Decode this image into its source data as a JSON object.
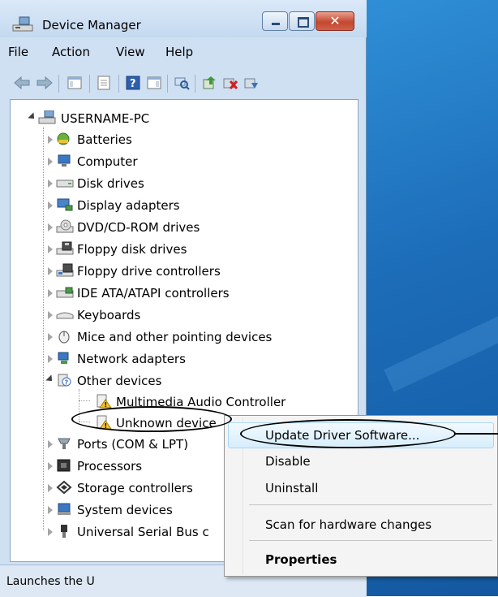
{
  "window": {
    "title": "Device Manager"
  },
  "menubar": {
    "items": [
      "File",
      "Action",
      "View",
      "Help"
    ]
  },
  "toolbar": {
    "icons": [
      "back-arrow-icon",
      "forward-arrow-icon",
      "show-hide-console-tree-icon",
      "properties-icon",
      "help-icon",
      "action-pane-icon",
      "scan-hardware-icon",
      "update-driver-icon",
      "uninstall-icon",
      "enable-device-icon"
    ]
  },
  "tree": {
    "root": "USERNAME-PC",
    "categories": [
      {
        "label": "Batteries",
        "icon": "battery-icon"
      },
      {
        "label": "Computer",
        "icon": "computer-icon"
      },
      {
        "label": "Disk drives",
        "icon": "disk-drive-icon"
      },
      {
        "label": "Display adapters",
        "icon": "display-adapter-icon"
      },
      {
        "label": "DVD/CD-ROM drives",
        "icon": "dvd-drive-icon"
      },
      {
        "label": "Floppy disk drives",
        "icon": "floppy-drive-icon"
      },
      {
        "label": "Floppy drive controllers",
        "icon": "floppy-controller-icon"
      },
      {
        "label": "IDE ATA/ATAPI controllers",
        "icon": "ide-controller-icon"
      },
      {
        "label": "Keyboards",
        "icon": "keyboard-icon"
      },
      {
        "label": "Mice and other pointing devices",
        "icon": "mouse-icon"
      },
      {
        "label": "Network adapters",
        "icon": "network-adapter-icon"
      },
      {
        "label": "Other devices",
        "icon": "unknown-device-icon"
      }
    ],
    "other_devices": [
      "Multimedia Audio Controller",
      "Unknown device"
    ],
    "categories_after": [
      {
        "label": "Ports (COM & LPT)",
        "icon": "port-icon"
      },
      {
        "label": "Processors",
        "icon": "processor-icon"
      },
      {
        "label": "Storage controllers",
        "icon": "storage-controller-icon"
      },
      {
        "label": "System devices",
        "icon": "system-device-icon"
      },
      {
        "label": "Universal Serial Bus c",
        "icon": "usb-icon"
      }
    ]
  },
  "context_menu": {
    "items": [
      "Update Driver Software...",
      "Disable",
      "Uninstall",
      "Scan for hardware changes",
      "Properties"
    ]
  },
  "statusbar": {
    "text": "Launches the U"
  },
  "colors": {
    "window_frame": "#cfe0f3",
    "desktop": "#1c6cb8",
    "menu_highlight": "#d6eefc",
    "close_button": "#c4472f"
  }
}
